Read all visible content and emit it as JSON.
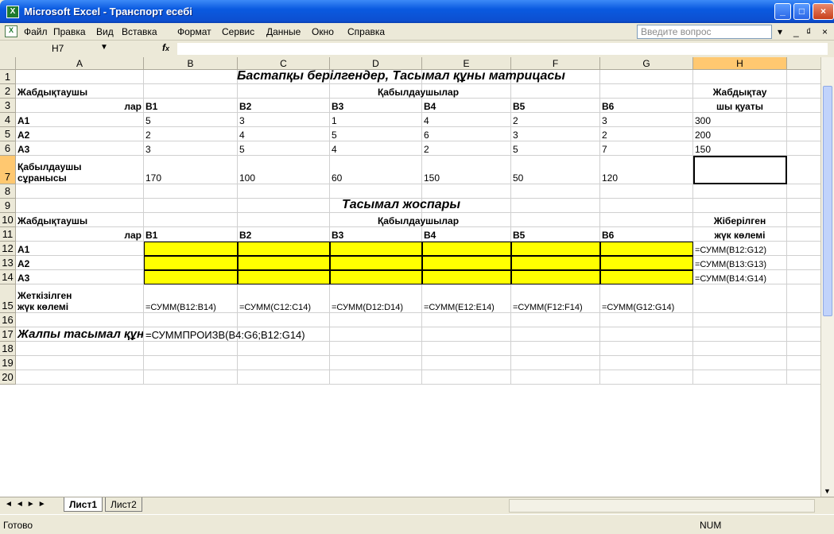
{
  "window": {
    "title": "Microsoft Excel - Транспорт есебі"
  },
  "menu": [
    "Файл",
    "Правка",
    "Вид",
    "Вставка",
    "Формат",
    "Сервис",
    "Данные",
    "Окно",
    "Справка"
  ],
  "ask_placeholder": "Введите вопрос",
  "namebox": "H7",
  "fx": "fx",
  "columns": [
    "A",
    "B",
    "C",
    "D",
    "E",
    "F",
    "G",
    "H"
  ],
  "rows": [
    "1",
    "2",
    "3",
    "4",
    "5",
    "6",
    "7",
    "8",
    "9",
    "10",
    "11",
    "12",
    "13",
    "14",
    "15",
    "16",
    "17",
    "18",
    "19",
    "20"
  ],
  "cells": {
    "title1": "Бастапқы берілгендер, Тасымал құны матрицасы",
    "supplier_head_1": "Жабдықтаушы",
    "supplier_head_2": "лар",
    "receivers": "Қабылдаушылар",
    "capacity_1": "Жабдықтау",
    "capacity_2": "шы қуаты",
    "b_headers": [
      "B1",
      "B2",
      "B3",
      "B4",
      "B5",
      "B6"
    ],
    "a_rows": [
      "A1",
      "A2",
      "A3"
    ],
    "cost_matrix": [
      [
        "5",
        "3",
        "1",
        "4",
        "2",
        "3"
      ],
      [
        "2",
        "4",
        "5",
        "6",
        "3",
        "2"
      ],
      [
        "3",
        "5",
        "4",
        "2",
        "5",
        "7"
      ]
    ],
    "capacities": [
      "300",
      "200",
      "150"
    ],
    "demand_1": "Қабылдаушы",
    "demand_2": "сұранысы",
    "demands": [
      "170",
      "100",
      "60",
      "150",
      "50",
      "120"
    ],
    "title2": "Тасымал жоспары",
    "sent_1": "Жіберілген",
    "sent_2": "жүк көлемі",
    "sent_formulas": [
      "=СУММ(B12:G12)",
      "=СУММ(B13:G13)",
      "=СУММ(B14:G14)"
    ],
    "delivered_1": "Жеткізілген",
    "delivered_2": "жүк көлемі",
    "delivered_formulas": [
      "=СУММ(B12:B14)",
      "=СУММ(C12:C14)",
      "=СУММ(D12:D14)",
      "=СУММ(E12:E14)",
      "=СУММ(F12:F14)",
      "=СУММ(G12:G14)"
    ],
    "total_label": "Жалпы тасымал құны F",
    "total_formula": "=СУММПРОИЗВ(B4:G6;B12:G14)"
  },
  "sheets": [
    "Лист1",
    "Лист2"
  ],
  "status": {
    "left": "Готово",
    "num": "NUM"
  },
  "colors": {
    "highlight": "#ffff00",
    "selected_header": "#ffc870"
  }
}
